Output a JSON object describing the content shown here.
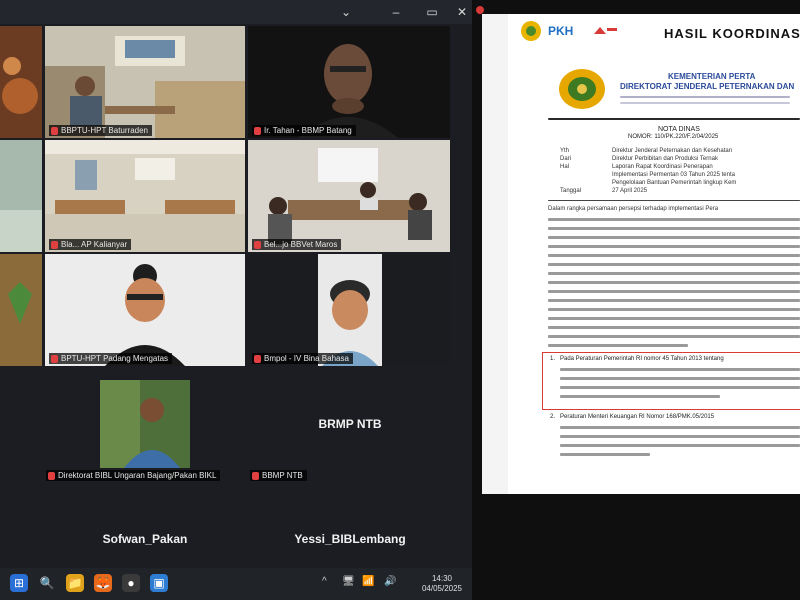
{
  "window": {
    "controls": [
      "⌄",
      "–",
      "▭",
      "✕"
    ]
  },
  "participants": [
    {
      "id": "p1",
      "label": "BBPTU-HPT Baturraden",
      "kind": "room"
    },
    {
      "id": "p2",
      "label": "Ir. Tahan - BBMP Batang",
      "kind": "portrait"
    },
    {
      "id": "p3",
      "label": "Bla... AP Kalianyar",
      "kind": "room"
    },
    {
      "id": "p4",
      "label": "Bel...jo BBVet Maros",
      "kind": "meeting"
    },
    {
      "id": "p5",
      "label": "BPTU-HPT Padang Mengatas",
      "kind": "avatar"
    },
    {
      "id": "p6",
      "label": "Bmpol - IV Bina Bahasa",
      "kind": "avatar"
    },
    {
      "id": "p7",
      "label": "Direktorat BIBL Ungaran Bajang/Pakan BIKL",
      "kind": "person"
    },
    {
      "id": "p8",
      "label": "BBMP NTB",
      "kind": "name-only"
    },
    {
      "id": "p9",
      "name": "Sofwan_Pakan",
      "kind": "name-only"
    },
    {
      "id": "p10",
      "name": "Yessi_BIBLembang",
      "kind": "name-only"
    }
  ],
  "big_names": {
    "p8": "BRMP NTB",
    "p9": "Sofwan_Pakan",
    "p10": "Yessi_BIBLembang"
  },
  "document": {
    "header_title": "HASIL KOORDINAS",
    "logo_text": "PKH",
    "ministry": "KEMENTERIAN PERTA",
    "directorate": "DIREKTORAT JENDERAL PETERNAKAN DAN",
    "nota_title": "NOTA DINAS",
    "nota_number": "NOMOR: 110/PK.220/F.2/04/2025",
    "fields": [
      {
        "key": "Yth",
        "value": "Direktur Jenderal Peternakan dan Kesehatan"
      },
      {
        "key": "Dari",
        "value": "Direktur Perbibitan dan Produksi Ternak"
      },
      {
        "key": "Hal",
        "value": "Laporan Rapat Koordinasi Penerapan"
      },
      {
        "key": "",
        "value": "Implementasi Permentan 03 Tahun 2025 tenta"
      },
      {
        "key": "",
        "value": "Pengelolaan Bantuan Pemerintah lingkup Kem"
      },
      {
        "key": "Tanggal",
        "value": "27 April 2025"
      }
    ],
    "paragraph_lead": "Dalam rangka persamaan persepsi terhadap implementasi Pera",
    "item1_num": "1.",
    "item1_text": "Pada Peraturan Pemerintah RI nomor 45 Tahun 2013 tentang",
    "item2_num": "2.",
    "item2_text": "Peraturan Menteri Keuangan RI Nomor 168/PMK.05/2015"
  },
  "taskbar": {
    "icons": [
      "⊞",
      "🔍",
      "📁",
      "🦊",
      "●",
      "▣"
    ],
    "tray": [
      "^",
      "🖥",
      "📶",
      "🔊"
    ],
    "time": "14:30",
    "date": "04/05/2025"
  }
}
